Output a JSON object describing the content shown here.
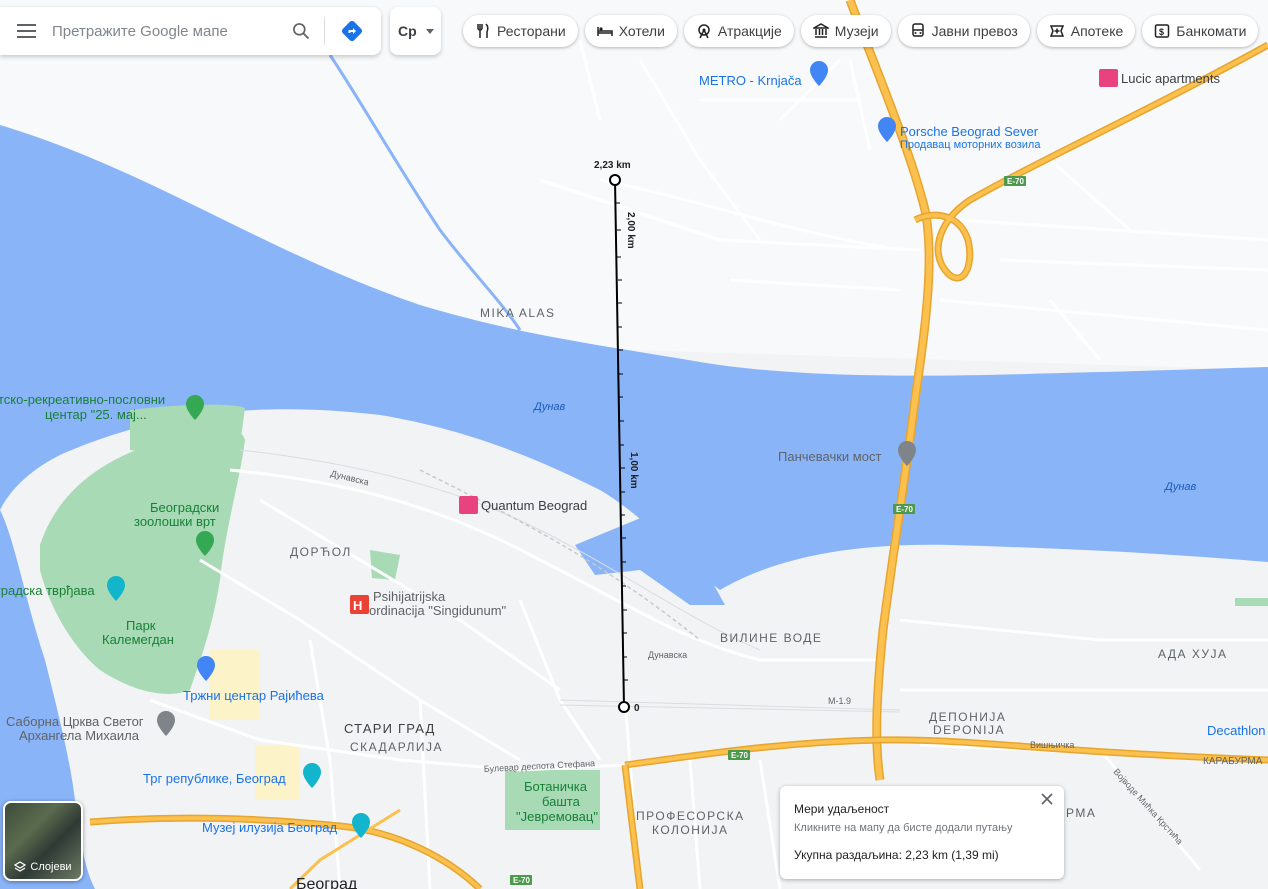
{
  "search": {
    "placeholder": "Претражите Google мапе"
  },
  "language": {
    "label": "Ср"
  },
  "chips": [
    {
      "label": "Ресторани",
      "icon": "fork-knife-icon"
    },
    {
      "label": "Хотели",
      "icon": "bed-icon"
    },
    {
      "label": "Атракције",
      "icon": "ferris-wheel-icon"
    },
    {
      "label": "Музеји",
      "icon": "museum-icon"
    },
    {
      "label": "Јавни превоз",
      "icon": "bus-icon"
    },
    {
      "label": "Апотеке",
      "icon": "pharmacy-icon"
    },
    {
      "label": "Банкомати",
      "icon": "atm-icon"
    }
  ],
  "map": {
    "districts": [
      "MIKA ALAS",
      "ДОРЋОЛ",
      "ВИЛИНЕ ВОДЕ",
      "АДА ХУЈА",
      "СТАРИ ГРАД",
      "СКАДАРЛИЈА",
      "ДЕПОНИЈА",
      "DEPONIJA",
      "ПРОФЕСОРСКА",
      "КОЛОНИЈА",
      "Београд",
      "РМА"
    ],
    "rivers": [
      "Дунав",
      "Дунав"
    ],
    "streets": [
      "Дунавска",
      "Дунавска",
      "Булевар деспота Стефана",
      "Вишњичка",
      "КАРАБУРМА",
      "Војводе Мићка Крстића",
      "M-1.9"
    ],
    "highway": "E-70",
    "places": [
      {
        "name": "METRO - Krnjača",
        "type": "shopping"
      },
      {
        "name": "Lucic apartments",
        "type": "hotel"
      },
      {
        "name": "Porsche Beograd Sever",
        "sub": "Продавац моторних возила",
        "type": "shopping"
      },
      {
        "name": "тско-рекреативно-пословни",
        "sub": "центар \"25. мај...",
        "type": "park"
      },
      {
        "name": "Панчевачки мост",
        "type": "landmark"
      },
      {
        "name": "Quantum Beograd",
        "type": "hotel"
      },
      {
        "name": "Београдски",
        "sub": "зоолошки врт",
        "type": "park"
      },
      {
        "name": "градска тврђава",
        "type": "museum"
      },
      {
        "name": "Psihijatrijska",
        "sub": "ordinacija \"Singidunum\"",
        "type": "hospital"
      },
      {
        "name": "Парк",
        "sub": "Калемегдан",
        "type": "park"
      },
      {
        "name": "Тржни центар Рајићева",
        "type": "shopping"
      },
      {
        "name": "Саборна Црква Светог",
        "sub": "Архангела Михаила",
        "type": "church"
      },
      {
        "name": "Трг републике, Београд",
        "type": "museum"
      },
      {
        "name": "Ботаничка",
        "sub": "башта",
        "sub2": "\"Јевремовац\"",
        "type": "park"
      },
      {
        "name": "Музеј илузија Београд",
        "type": "museum"
      },
      {
        "name": "Decathlon",
        "type": "shopping"
      }
    ],
    "measure": {
      "start_label": "0",
      "end_label": "2,23 km",
      "mid_label": "1,00 km",
      "top_label": "2,00 km"
    }
  },
  "layers": {
    "label": "Слојеви"
  },
  "measure_card": {
    "title": "Мери удаљеност",
    "hint": "Кликните на мапу да бисте додали путању",
    "total": "Укупна раздаљина: 2,23 km (1,39 mi)"
  },
  "colors": {
    "water": "#8ab4f8",
    "park": "#a8dab5",
    "highway": "#fbc04d",
    "highway_edge": "#e6a52e",
    "accent": "#1a73e8",
    "hotel": "#e8437f",
    "hospital": "#ea4335"
  }
}
